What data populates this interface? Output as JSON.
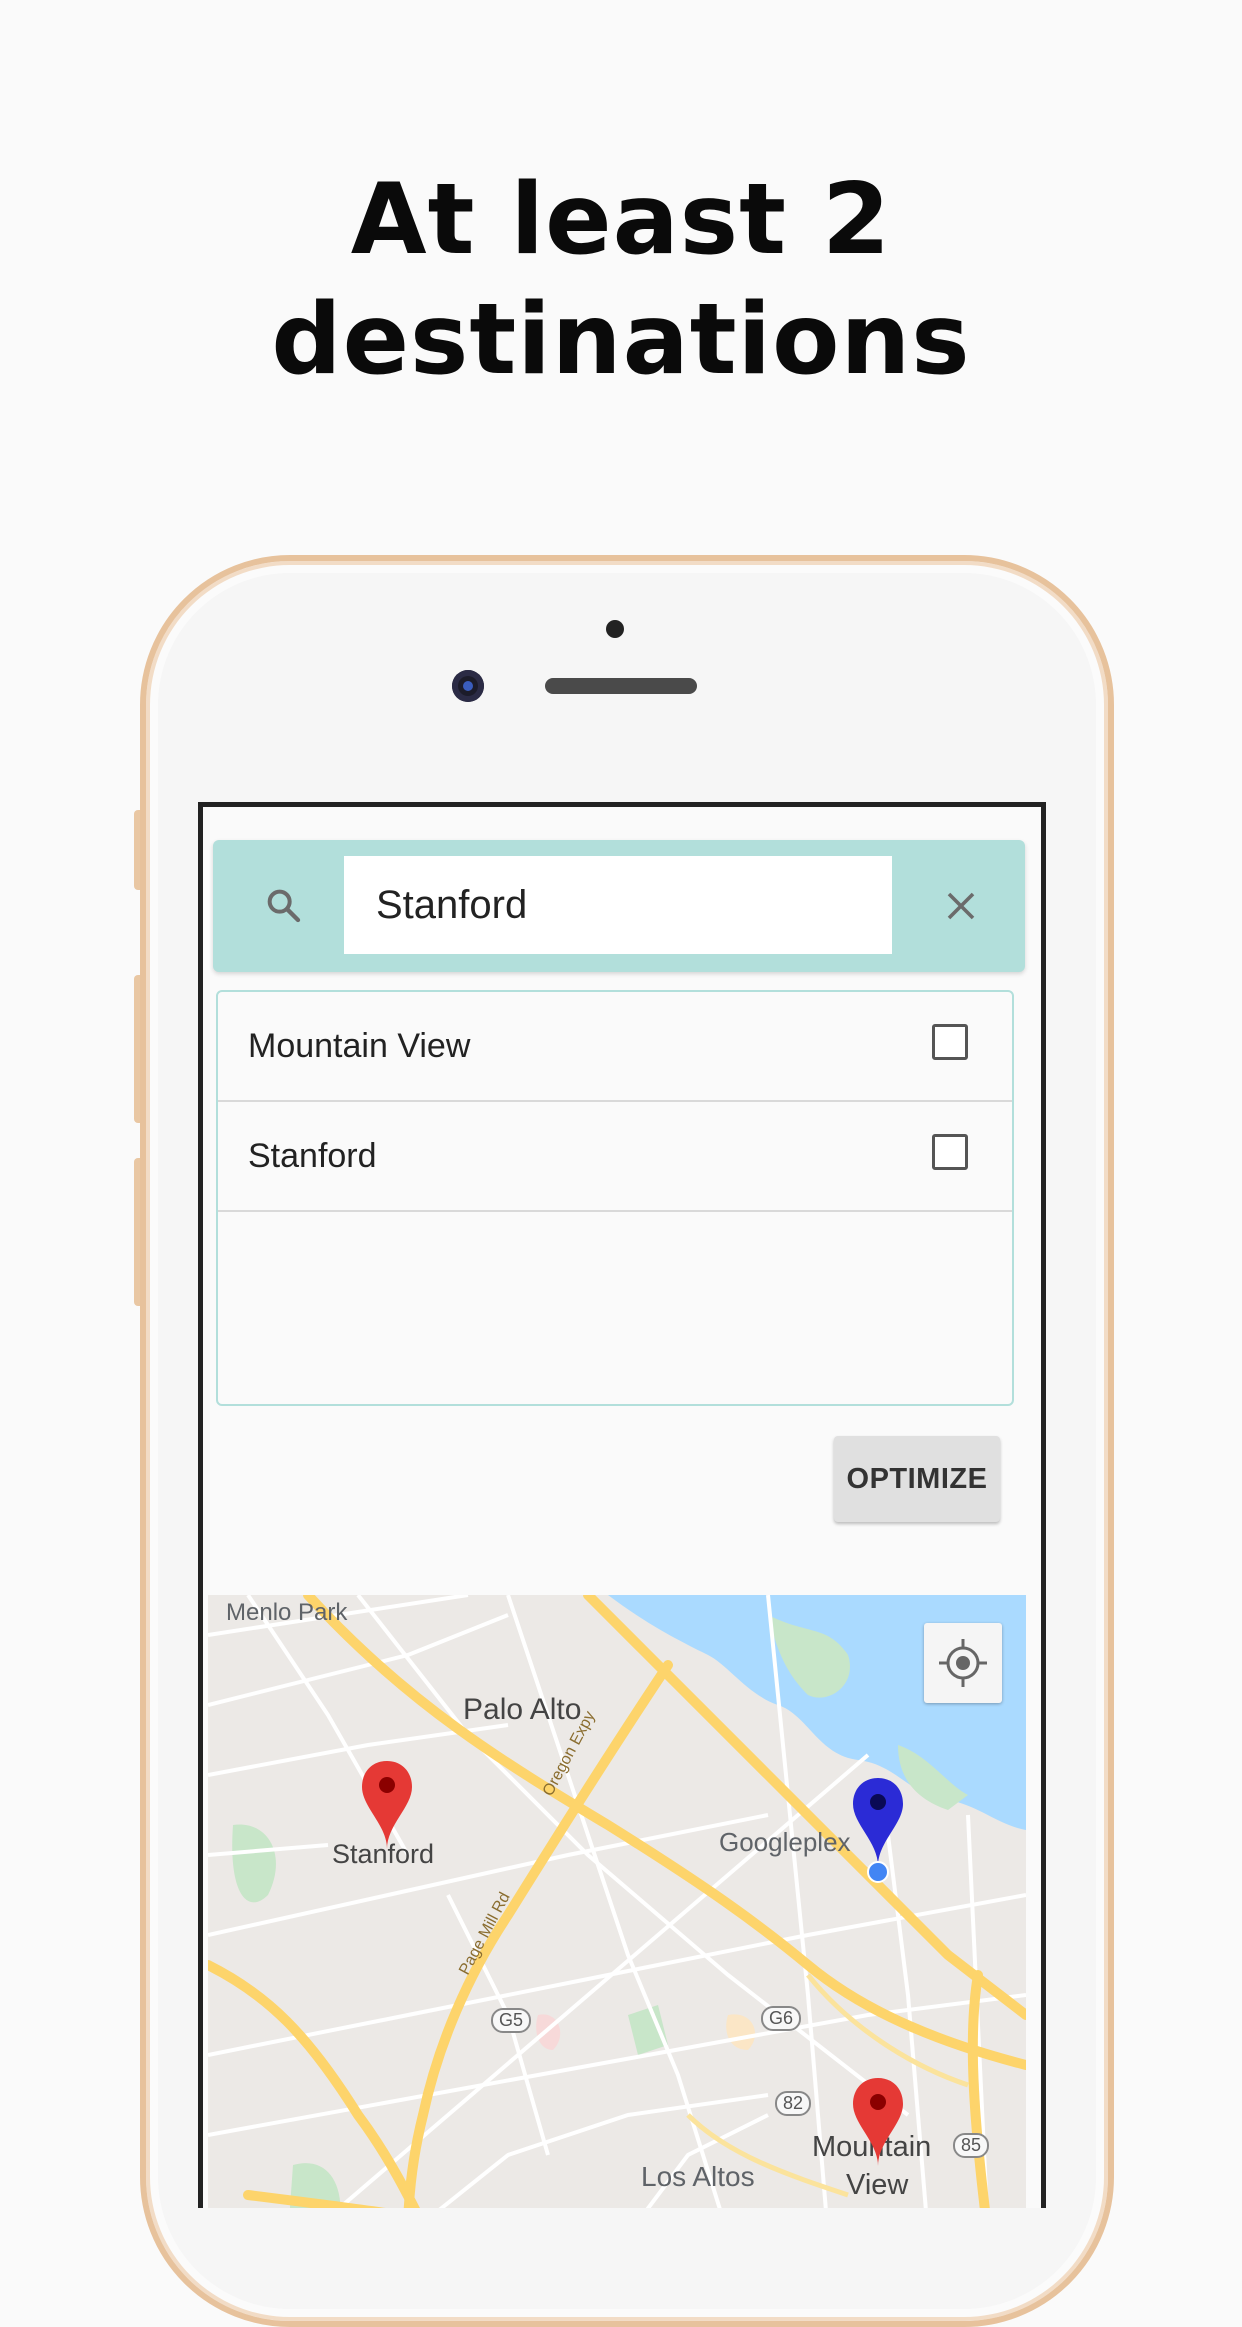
{
  "headline": "At least 2 destinations",
  "search": {
    "value": "Stanford"
  },
  "destinations": [
    {
      "label": "Mountain View",
      "checked": false
    },
    {
      "label": "Stanford",
      "checked": false
    }
  ],
  "optimize_label": "OPTIMIZE",
  "map": {
    "labels": {
      "menlo_park": "Menlo Park",
      "palo_alto": "Palo Alto",
      "stanford": "Stanford",
      "googleplex": "Googleplex",
      "oregon_expy": "Oregon Expy",
      "page_mill": "Page Mill Rd",
      "g5": "G5",
      "g6": "G6",
      "r82": "82",
      "r85": "85",
      "los_altos": "Los Altos",
      "mountain": "Mountain",
      "view": "View"
    },
    "colors": {
      "red_pin": "#e53935",
      "blue_pin": "#2b2bd6",
      "water": "#aadaff",
      "road_major": "#fdd46b"
    }
  }
}
